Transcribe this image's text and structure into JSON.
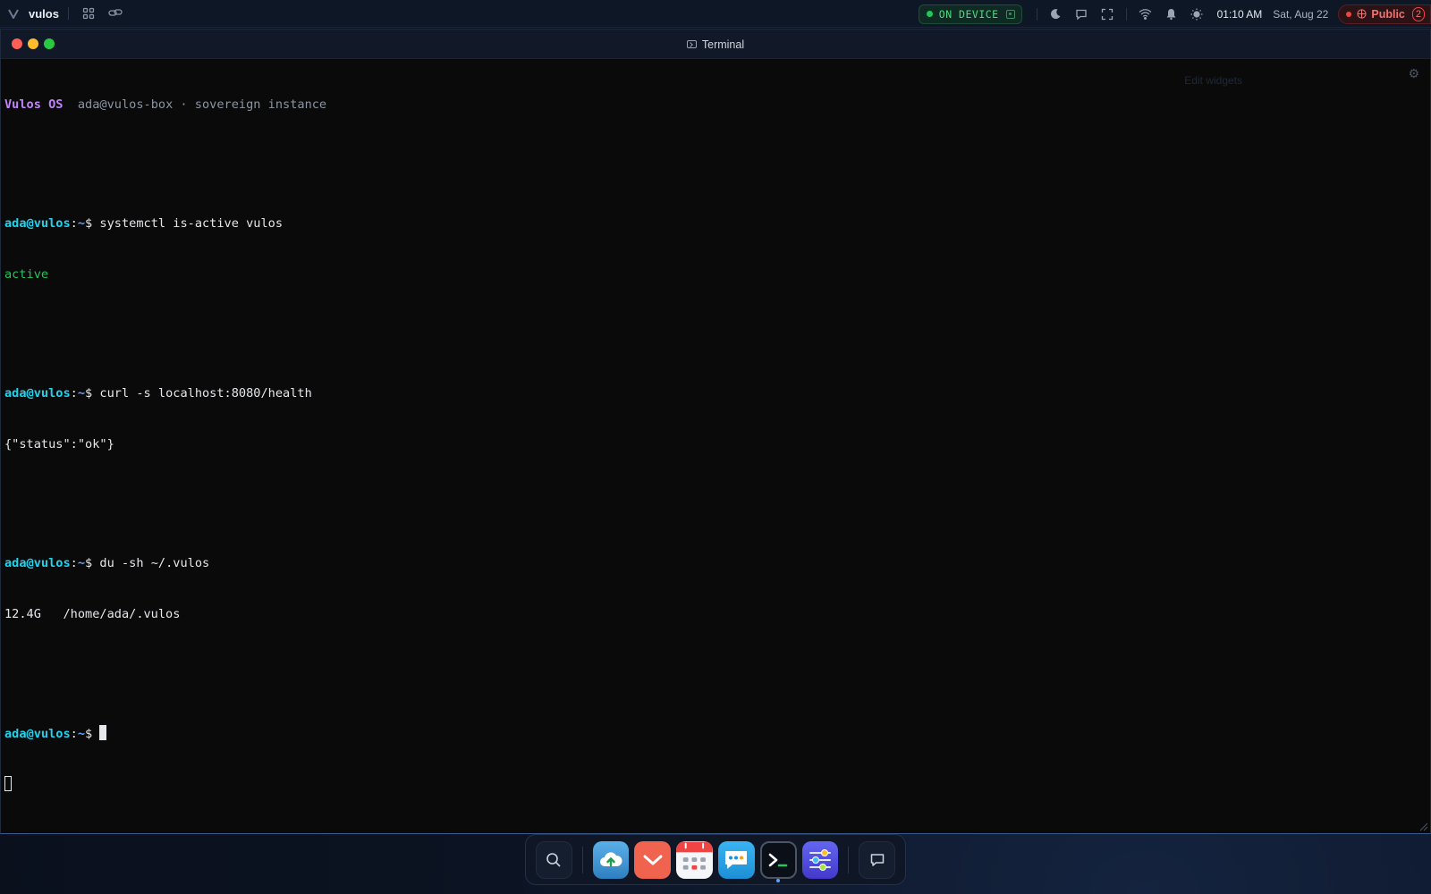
{
  "topbar": {
    "brand": "vulos",
    "device_status": "ON DEVICE",
    "time": "01:10 AM",
    "date": "Sat, Aug 22",
    "visibility_label": "Public",
    "visibility_count": "2"
  },
  "window": {
    "title": "Terminal",
    "ghost_text": "Edit widgets"
  },
  "terminal": {
    "banner": {
      "os_name": "Vulos OS",
      "host_info": "ada@vulos-box · sovereign instance"
    },
    "prompt": {
      "user_host": "ada@vulos",
      "colon": ":",
      "path": "~",
      "symbol": "$ "
    },
    "entries": [
      {
        "command": "systemctl is-active vulos",
        "output": "active"
      },
      {
        "command": "curl -s localhost:8080/health",
        "output": "{\"status\":\"ok\"}"
      },
      {
        "command": "du -sh ~/.vulos",
        "output": "12.4G   /home/ada/.vulos"
      }
    ]
  },
  "dock": {
    "apps": [
      "search",
      "upload",
      "tasks",
      "calendar",
      "chat",
      "terminal",
      "settings",
      "messages"
    ],
    "active_app": "terminal"
  },
  "colors": {
    "accent": "#22d3ee",
    "prompt_path": "#60a5fa",
    "success": "#22c55e",
    "banner": "#c084fc",
    "public_red": "#ef4444"
  }
}
